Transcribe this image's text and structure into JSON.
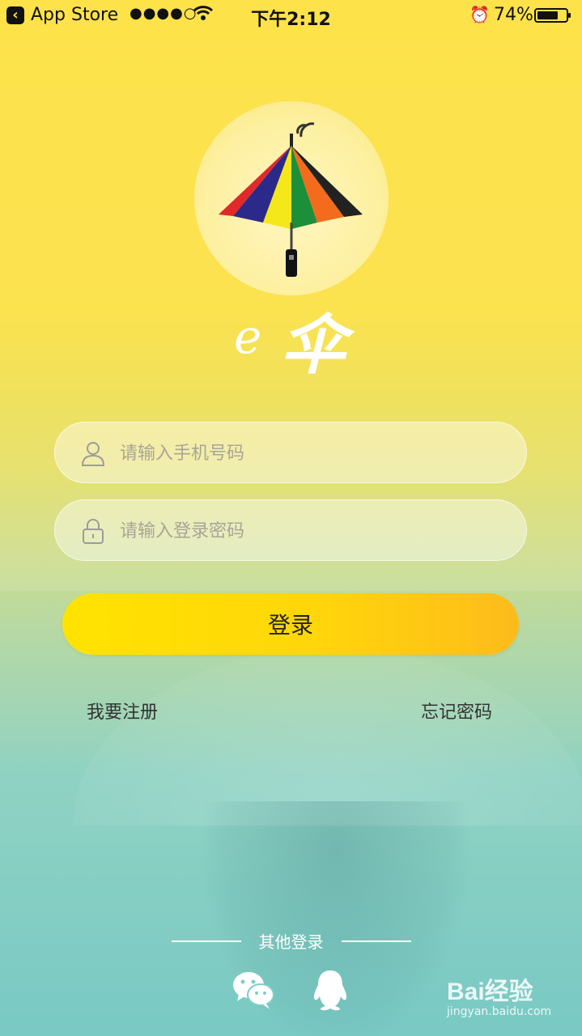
{
  "status_bar": {
    "back_app": "App Store",
    "signal": "●●●●○",
    "time": "下午2:12",
    "battery_text": "74%",
    "battery_level": 0.74
  },
  "brand": {
    "e_text": "e",
    "name_text": "伞"
  },
  "phone_field": {
    "placeholder": "请输入手机号码",
    "value": ""
  },
  "password_field": {
    "placeholder": "请输入登录密码",
    "value": ""
  },
  "login_button": "登录",
  "register_link": "我要注册",
  "forgot_link": "忘记密码",
  "other_login_label": "其他登录",
  "watermark": {
    "main": "Bai经验",
    "sub": "jingyan.baidu.com"
  },
  "colors": {
    "accent_yellow": "#ffe300",
    "accent_orange": "#fdbb1c",
    "background_top": "#fde24a",
    "background_bottom": "#79c9c4"
  }
}
